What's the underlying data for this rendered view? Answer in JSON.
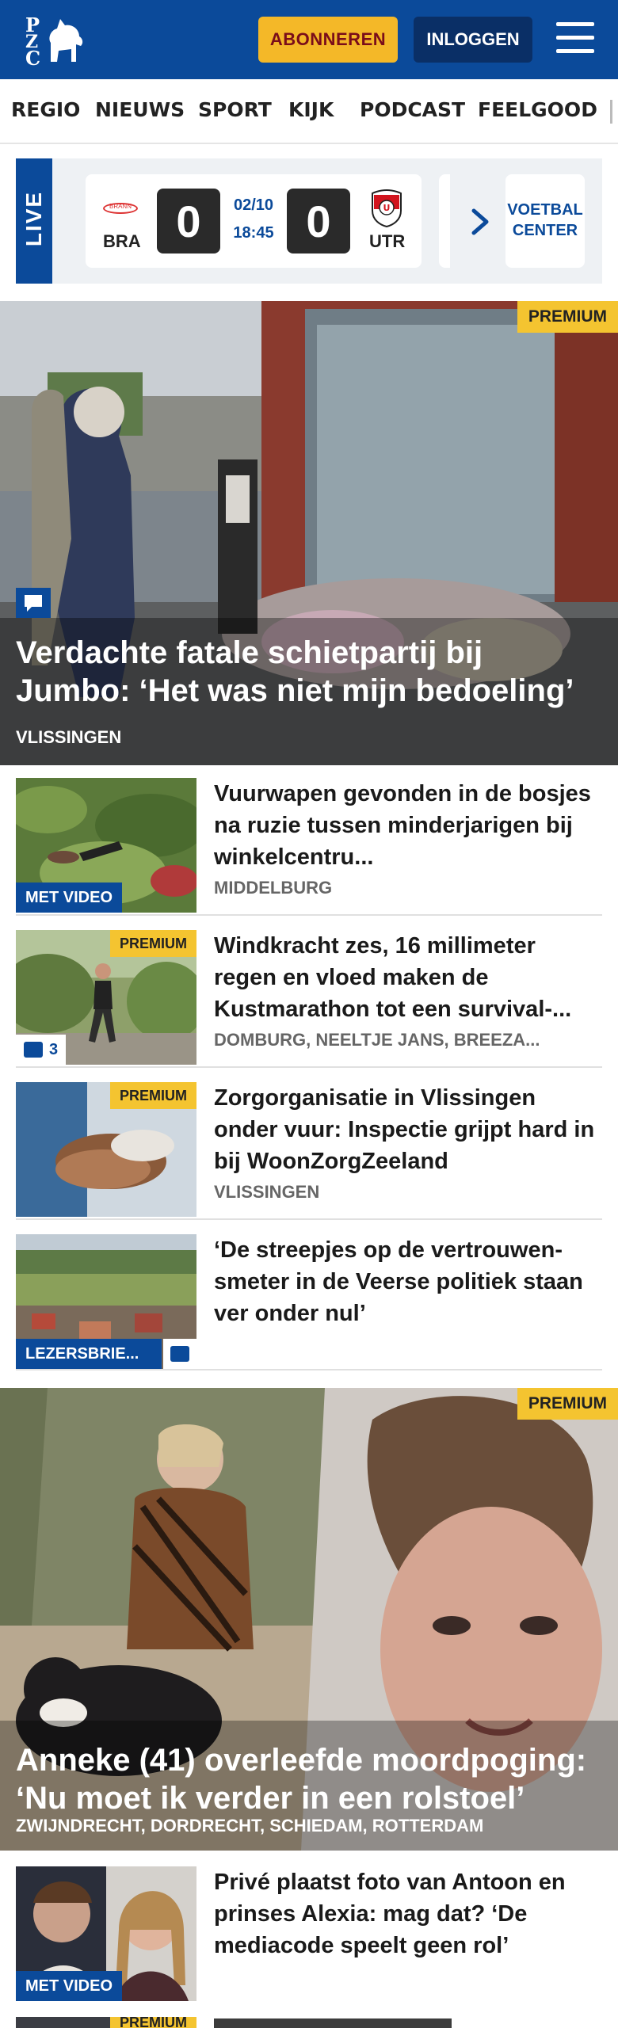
{
  "header": {
    "logo_text": "PZC",
    "subscribe_label": "ABONNEREN",
    "login_label": "INLOGGEN"
  },
  "nav": {
    "items": [
      "REGIO",
      "NIEUWS",
      "SPORT",
      "KIJK",
      "PODCAST",
      "FEELGOOD"
    ]
  },
  "live": {
    "label": "LIVE",
    "home_team": "BRA",
    "home_logo_text": "BRANN",
    "home_score": "0",
    "date": "02/10",
    "time": "18:45",
    "away_score": "0",
    "away_team": "UTR",
    "voetbal_center": "VOETBAL CENTER"
  },
  "hero1": {
    "premium": "PREMIUM",
    "title": "Verdachte fatale schietpartij bij Jumbo: ‘Het was niet mijn bedoeling’",
    "location": "VLISSINGEN"
  },
  "articles": [
    {
      "title": "Vuurwapen gevonden in de bosjes na ruzie tussen minderjarigen bij winkelcentru...",
      "location": "MIDDELBURG",
      "badge": "MET VIDEO"
    },
    {
      "title": "Windkracht zes, 16 millimeter regen en vloed maken de Kustmarathon tot een survival-...",
      "location": "DOMBURG, NEELTJE JANS, BREEZA...",
      "premium": "PREMIUM",
      "comments": "3"
    },
    {
      "title": "Zorgorganisatie in Vlissingen onder vuur: Inspectie grijpt hard in bij WoonZorgZeeland",
      "location": "VLISSINGEN",
      "premium": "PREMIUM"
    },
    {
      "title": "‘De streepjes op de vertrouwen­smeter in de Veerse politiek staan ver onder nul’",
      "badge": "LEZERSBRIE..."
    }
  ],
  "hero2": {
    "premium": "PREMIUM",
    "title": "Anneke (41) overleefde moordpoging: ‘Nu moet ik verder in een rolstoel’",
    "location": "ZWIJNDRECHT, DORDRECHT, SCHIEDAM, ROTTERDAM"
  },
  "article_last": {
    "title": "Privé plaatst foto van Antoon en prinses Alexia: mag dat? ‘De mediacode speelt geen rol’",
    "badge": "MET VIDEO"
  },
  "next_partial": {
    "premium": "PREMIUM"
  },
  "colors": {
    "brand_blue": "#0b4a9a",
    "accent_yellow": "#f4b828",
    "premium_yellow": "#f4c430"
  }
}
